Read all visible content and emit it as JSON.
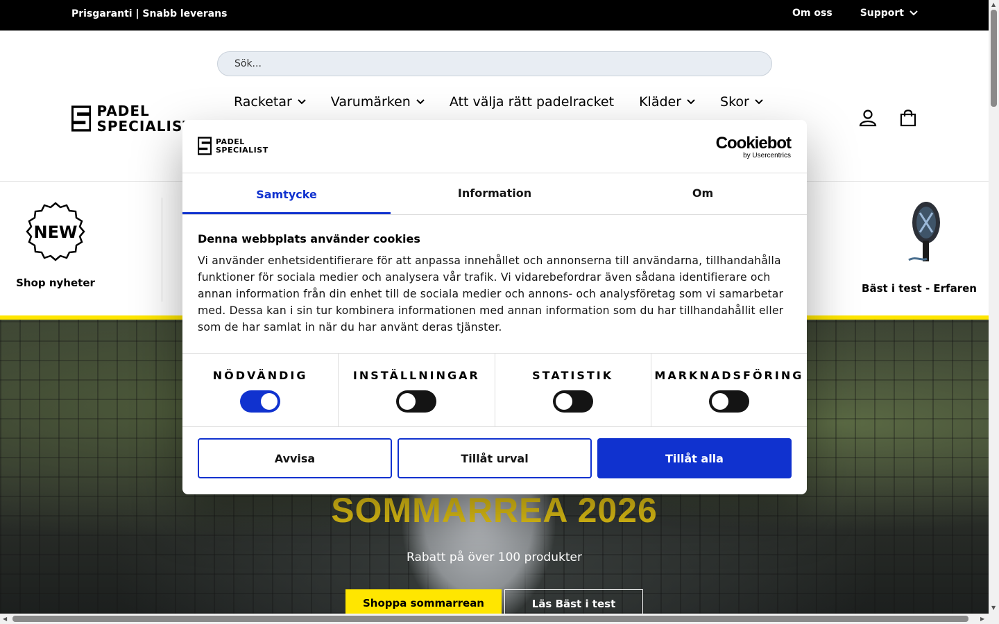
{
  "topbar": {
    "promo": "Prisgaranti | Snabb leverans",
    "about": "Om oss",
    "support": "Support"
  },
  "header": {
    "search_placeholder": "Sök...",
    "logo_line1": "PADEL",
    "logo_line2": "SPECIALIST",
    "nav": {
      "racketar": "Racketar",
      "varumarken": "Varumärken",
      "guide": "Att välja rätt padelracket",
      "klader": "Kläder",
      "skor": "Skor"
    }
  },
  "categories": {
    "new_badge": "NEW",
    "new_label": "Shop nyheter",
    "test_label": "Bäst i test - Erfaren"
  },
  "hero": {
    "title": "SOMMARREA 2026",
    "subtitle": "Rabatt på över 100 produkter",
    "cta_primary": "Shoppa sommarrean",
    "cta_secondary": "Läs Bäst i test"
  },
  "cookie": {
    "logo_line1": "PADEL",
    "logo_line2": "SPECIALIST",
    "brand": "Cookiebot",
    "brand_sub": "by Usercentrics",
    "tabs": {
      "consent": "Samtycke",
      "information": "Information",
      "about": "Om"
    },
    "heading": "Denna webbplats använder cookies",
    "body": "Vi använder enhetsidentifierare för att anpassa innehållet och annonserna till användarna, tillhandahålla funktioner för sociala medier och analysera vår trafik. Vi vidarebefordrar även sådana identifierare och annan information från din enhet till de sociala medier och annons- och analysföretag som vi samarbetar med. Dessa kan i sin tur kombinera informationen med annan information som du har tillhandahållit eller som de har samlat in när du har använt deras tjänster.",
    "toggles": {
      "necessary": {
        "label": "NÖDVÄNDIG",
        "on": true
      },
      "preferences": {
        "label": "INSTÄLLNINGAR",
        "on": false
      },
      "statistics": {
        "label": "STATISTIK",
        "on": false
      },
      "marketing": {
        "label": "MARKNADSFÖRING",
        "on": false
      }
    },
    "buttons": {
      "deny": "Avvisa",
      "allow_selection": "Tillåt urval",
      "allow_all": "Tillåt alla"
    },
    "accent_color": "#1032cf"
  }
}
